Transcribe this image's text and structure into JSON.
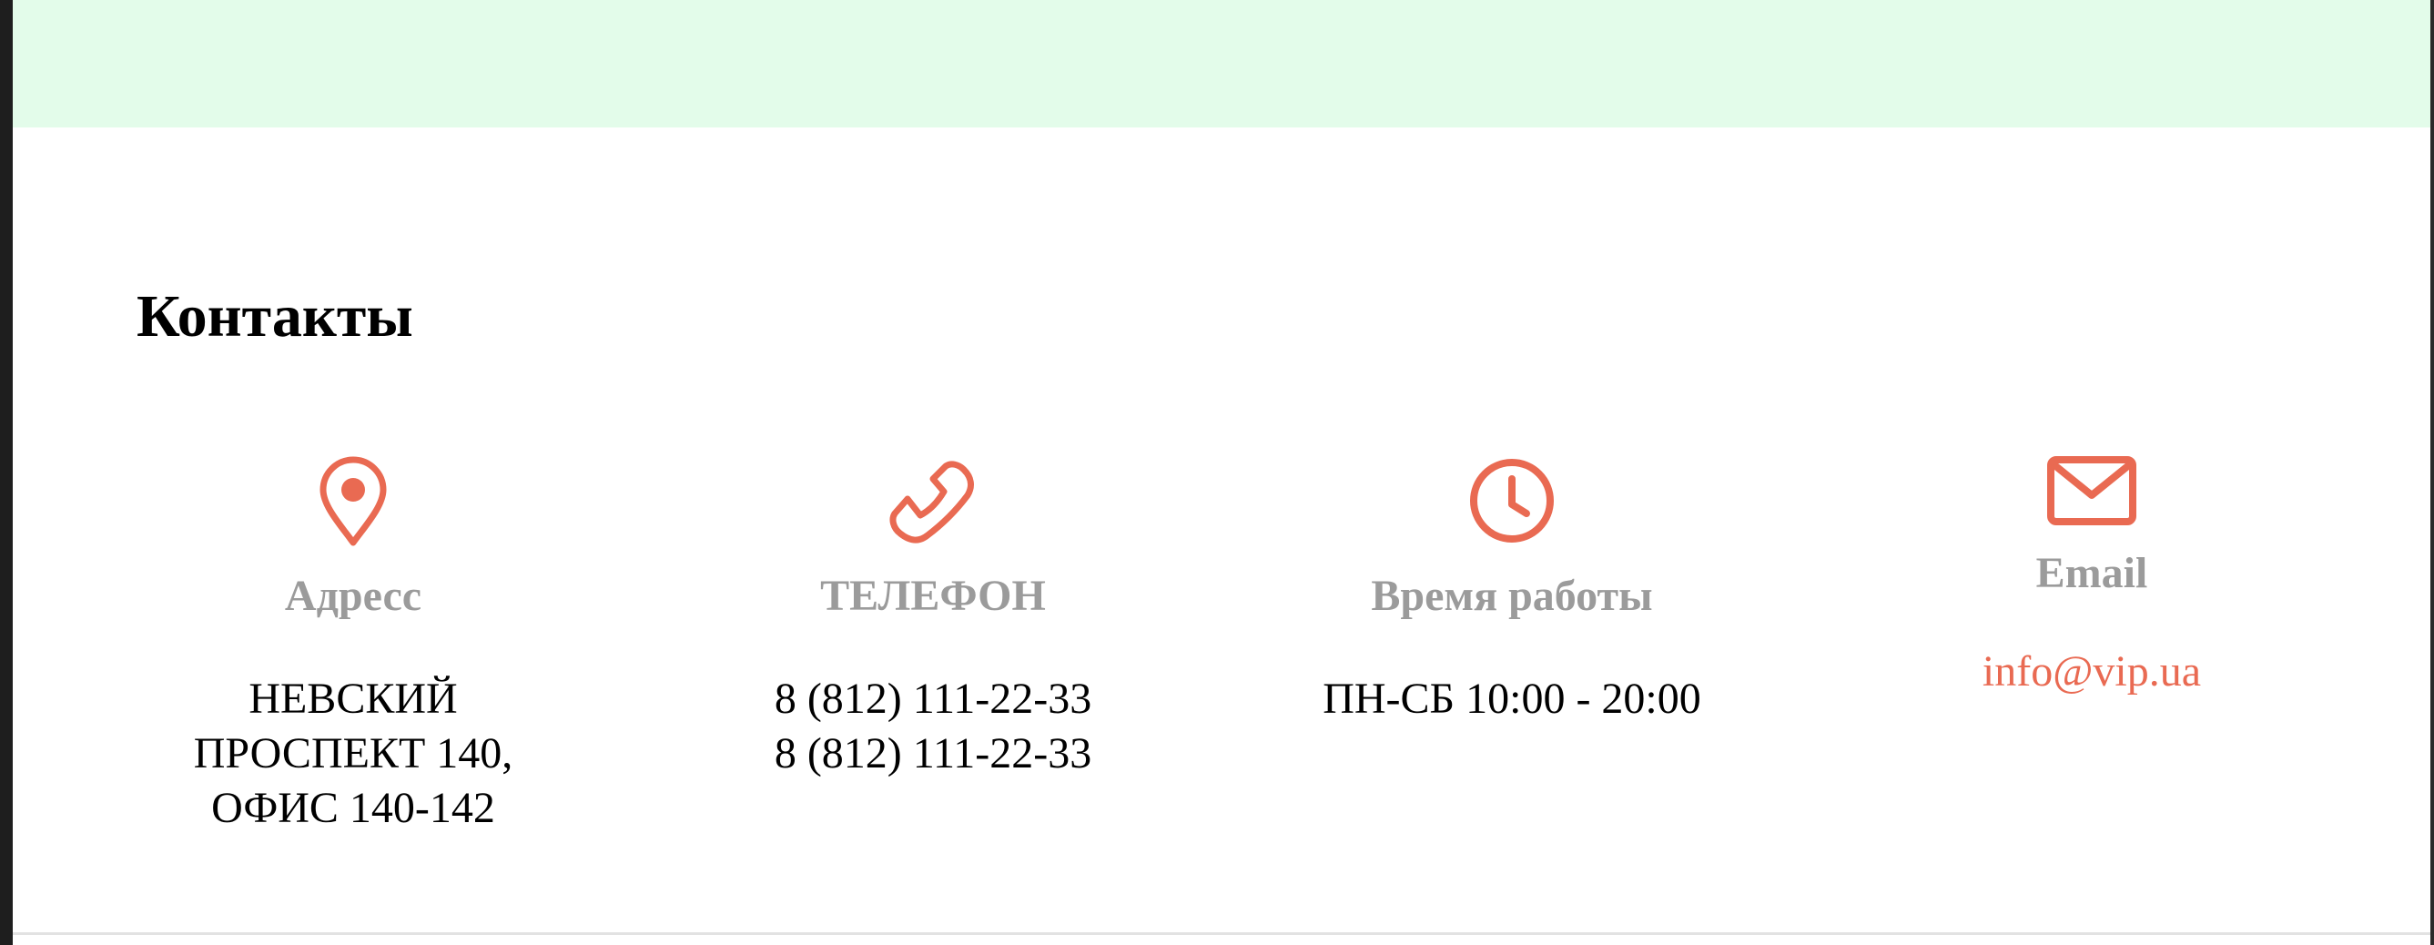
{
  "section": {
    "title": "Контакты"
  },
  "contacts": [
    {
      "icon": "location-pin-icon",
      "label": "Адресс",
      "value": "НЕВСКИЙ ПРОСПЕКТ 140, ОФИС 140-142"
    },
    {
      "icon": "phone-icon",
      "label": "ТЕЛЕФОН",
      "value": "8 (812) 111-22-33 8 (812) 111-22-33"
    },
    {
      "icon": "clock-icon",
      "label": "Время работы",
      "value": "ПН-СБ 10:00 - 20:00"
    },
    {
      "icon": "envelope-icon",
      "label": "Email",
      "value": "info@vip.ua"
    }
  ],
  "colors": {
    "accent": "#e96a52",
    "label_gray": "#9b9b9b",
    "top_band": "#e3fcea"
  }
}
